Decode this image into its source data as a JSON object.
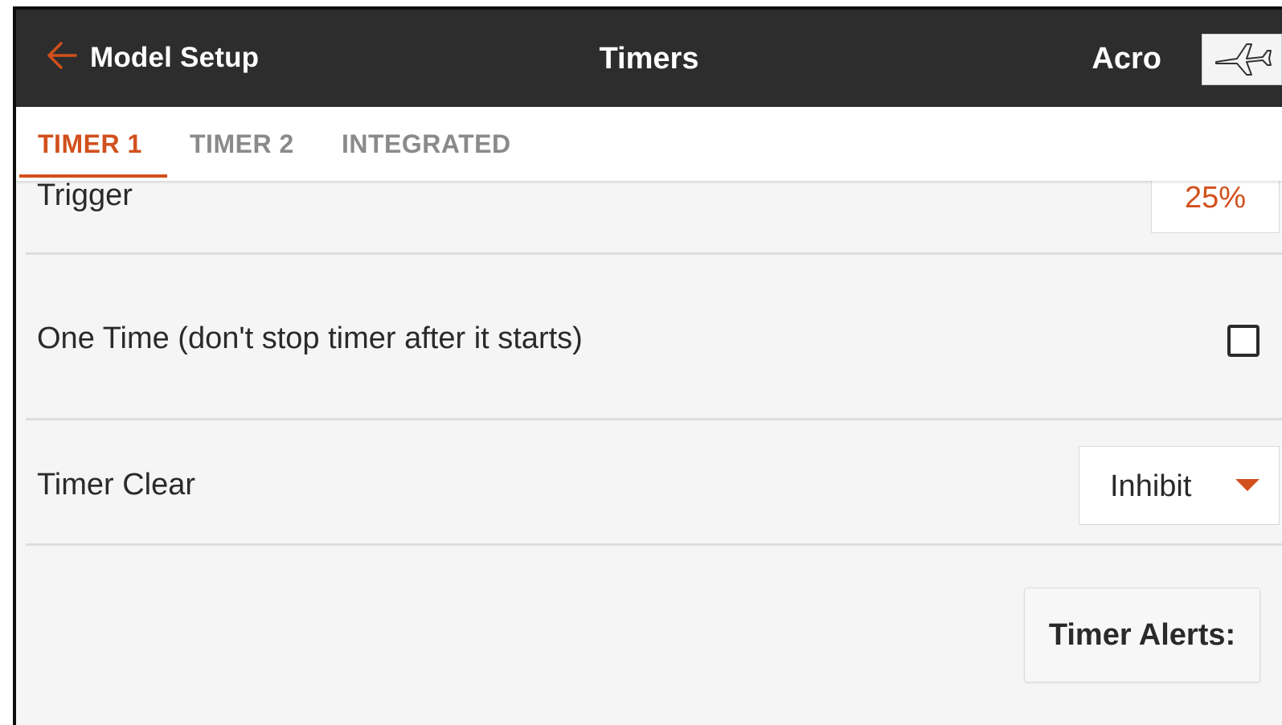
{
  "header": {
    "back_label": "Model Setup",
    "title": "Timers",
    "mode": "Acro",
    "model_icon": "airplane-icon"
  },
  "tabs": [
    {
      "label": "TIMER 1",
      "active": true
    },
    {
      "label": "TIMER 2",
      "active": false
    },
    {
      "label": "INTEGRATED",
      "active": false
    }
  ],
  "rows": {
    "trigger": {
      "label": "Trigger",
      "value": "25%"
    },
    "one_time": {
      "label": "One Time (don't stop timer after it starts)",
      "checked": false
    },
    "timer_clear": {
      "label": "Timer Clear",
      "value": "Inhibit"
    }
  },
  "timer_alerts_label": "Timer Alerts:",
  "colors": {
    "header_bg": "#2d2d2d",
    "accent": "#d2501c",
    "content_bg": "#f5f5f5"
  }
}
